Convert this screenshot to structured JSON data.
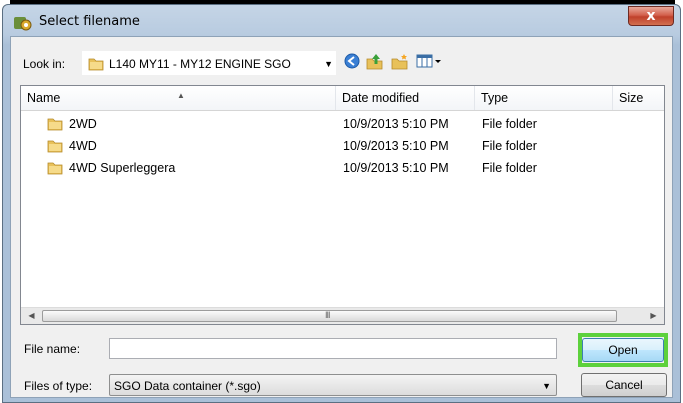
{
  "window": {
    "title": "Select filename",
    "close_label": "x"
  },
  "toolbar": {
    "lookin_label": "Look in:",
    "lookin_value": "L140 MY11 - MY12  ENGINE SGO",
    "icons": [
      "back-icon",
      "up-folder-icon",
      "new-folder-icon",
      "view-menu-icon"
    ]
  },
  "list": {
    "columns": [
      "Name",
      "Date modified",
      "Type",
      "Size"
    ],
    "rows": [
      {
        "name": "2WD",
        "date": "10/9/2013 5:10 PM",
        "type": "File folder"
      },
      {
        "name": "4WD",
        "date": "10/9/2013 5:10 PM",
        "type": "File folder"
      },
      {
        "name": "4WD Superleggera",
        "date": "10/9/2013 5:10 PM",
        "type": "File folder"
      }
    ],
    "scroll_grip": "III"
  },
  "form": {
    "filename_label": "File name:",
    "filename_value": "",
    "filetype_label": "Files of type:",
    "filetype_value": "SGO Data container (*.sgo)",
    "open_label": "Open",
    "cancel_label": "Cancel"
  },
  "colors": {
    "highlight": "#5dd13c",
    "folder": "#e8c15a"
  }
}
